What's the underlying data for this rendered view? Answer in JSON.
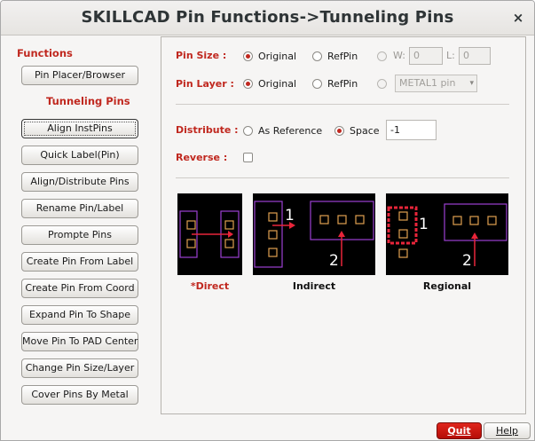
{
  "window": {
    "title": "SKILLCAD Pin Functions->Tunneling Pins",
    "close_glyph": "×"
  },
  "left": {
    "functions_label": "Functions",
    "pin_placer_button": "Pin Placer/Browser",
    "tunneling_label": "Tunneling Pins",
    "buttons": [
      "Align InstPins",
      "Quick Label(Pin)",
      "Align/Distribute Pins",
      "Rename Pin/Label",
      "Prompte Pins",
      "Create Pin From Label",
      "Create Pin From Coord",
      "Expand Pin To Shape",
      "Move Pin To PAD Center",
      "Change Pin Size/Layer",
      "Cover Pins By Metal"
    ]
  },
  "form": {
    "pin_size": {
      "label": "Pin Size :",
      "opt_original": "Original",
      "opt_refpin": "RefPin",
      "selected": "Original",
      "w_label": "W:",
      "w_value": "0",
      "l_label": "L:",
      "l_value": "0"
    },
    "pin_layer": {
      "label": "Pin Layer :",
      "opt_original": "Original",
      "opt_refpin": "RefPin",
      "selected": "Original",
      "layer_value": "METAL1 pin"
    },
    "distribute": {
      "label": "Distribute :",
      "opt_reference": "As Reference",
      "opt_space": "Space",
      "selected": "Space",
      "space_value": "-1"
    },
    "reverse": {
      "label": "Reverse :",
      "checked": false
    }
  },
  "diagrams": {
    "direct_caption": "*Direct",
    "indirect_caption": "Indirect",
    "regional_caption": "Regional",
    "step_one": "1",
    "step_two": "2"
  },
  "footer": {
    "quit_label": "Quit",
    "help_label": "Help"
  },
  "colors": {
    "accent_red": "#c0281f",
    "quit_red": "#cc1a12",
    "diagram_bg": "#000000",
    "diagram_box": "#9b3fd1",
    "diagram_pin": "#e0a050",
    "diagram_arrow": "#e8253a"
  },
  "icons": {
    "close": "close-icon",
    "arrow": "arrow-icon",
    "dropdown": "chevron-down-icon"
  }
}
